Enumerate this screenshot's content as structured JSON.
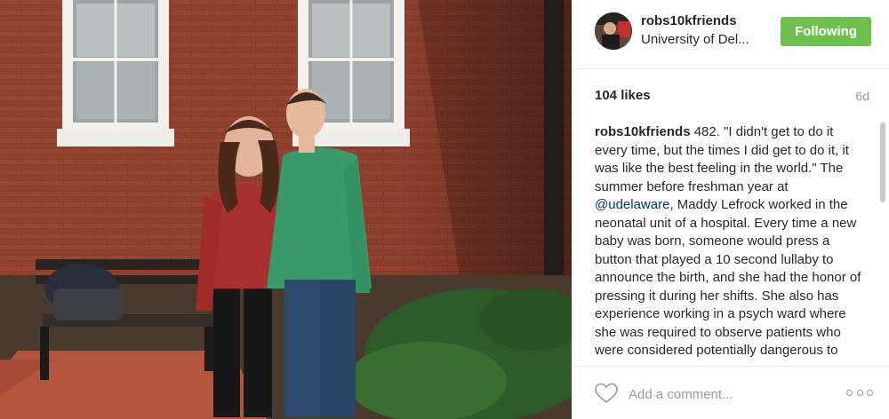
{
  "post": {
    "photo_description_icon": "photo-image",
    "header": {
      "username": "robs10kfriends",
      "location": "University of Del...",
      "follow_label": "Following"
    },
    "likes": "104 likes",
    "time": "6d",
    "caption": {
      "username": "robs10kfriends",
      "text_before_mention": " 482. \"I didn't get to do it every time, but the times I did get to do it, it was like the best feeling in the world.\" The summer before freshman year at ",
      "mention": "@udelaware",
      "text_after_mention": ", Maddy Lefrock worked in the neonatal unit of a hospital. Every time a new baby was born, someone would press a button that played a 10 second lullaby to announce the birth, and she had the honor of pressing it during her shifts. She also has experience working in a psych ward where she was required to observe patients who were considered potentially dangerous to"
    },
    "comment_placeholder": "Add a comment...",
    "icons": {
      "heart": "heart-icon",
      "more": "more-options-icon"
    },
    "colors": {
      "follow_button": "#70c050",
      "mention": "#003569",
      "muted_text": "#999999"
    }
  }
}
